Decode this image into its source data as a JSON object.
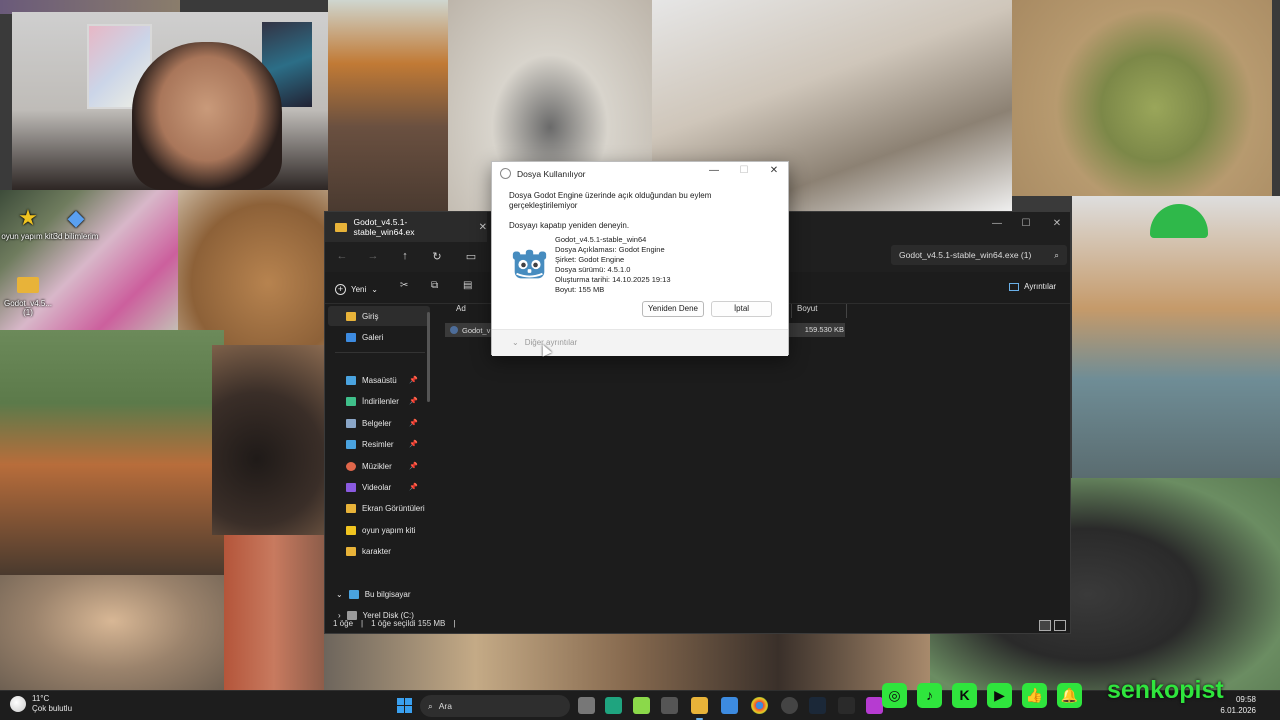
{
  "desktop": {
    "icons": [
      {
        "label": "oyun yapım kiti",
        "icon": "star-shortcut-icon"
      },
      {
        "label": "3d bilimlerim",
        "icon": "paint-3d-icon"
      },
      {
        "label": "Godot_v4.5...(1)",
        "icon": "folder-icon"
      }
    ]
  },
  "explorer": {
    "tab_title": "Godot_v4.5.1-stable_win64.ex",
    "search_placeholder": "Godot_v4.5.1-stable_win64.exe (1)",
    "toolbar": {
      "new_label": "Yeni",
      "details_label": "Ayrıntılar"
    },
    "sidebar": {
      "items": [
        {
          "label": "Giriş",
          "icon": "home-icon",
          "color": "#e8b339"
        },
        {
          "label": "Galeri",
          "icon": "gallery-icon",
          "color": "#3d8be0"
        },
        {
          "label": "Masaüstü",
          "icon": "desktop-icon",
          "color": "#4aa3df"
        },
        {
          "label": "İndirilenler",
          "icon": "download-icon",
          "color": "#3fbf8a"
        },
        {
          "label": "Belgeler",
          "icon": "documents-icon",
          "color": "#8aa6c8"
        },
        {
          "label": "Resimler",
          "icon": "pictures-icon",
          "color": "#4aa3df"
        },
        {
          "label": "Müzikler",
          "icon": "music-icon",
          "color": "#e0664a"
        },
        {
          "label": "Videolar",
          "icon": "videos-icon",
          "color": "#8a5ae0"
        },
        {
          "label": "Ekran Görüntüleri",
          "icon": "folder-icon",
          "color": "#e8b339"
        },
        {
          "label": "oyun yapım kiti",
          "icon": "star-folder-icon",
          "color": "#f0c420"
        },
        {
          "label": "karakter",
          "icon": "folder-icon",
          "color": "#e8b339"
        },
        {
          "label": "Bu bilgisayar",
          "icon": "computer-icon",
          "color": "#4aa3df"
        },
        {
          "label": "Yerel Disk (C:)",
          "icon": "drive-icon",
          "color": "#9a9a9a"
        }
      ]
    },
    "columns": {
      "name": "Ad",
      "size": "Boyut"
    },
    "file": {
      "name": "Godot_v",
      "size": "159.530 KB"
    },
    "status": {
      "count": "1 öğe",
      "selected": "1 öğe seçildi  155 MB"
    }
  },
  "dialog": {
    "title": "Dosya Kullanılıyor",
    "message": "Dosya Godot Engine üzerinde açık olduğundan bu eylem gerçekleştirilemiyor",
    "retry_hint": "Dosyayı kapatıp yeniden deneyin.",
    "info": [
      "Godot_v4.5.1-stable_win64",
      "Dosya Açıklaması: Godot Engine",
      "Şirket: Godot Engine",
      "Dosya sürümü: 4.5.1.0",
      "Oluşturma tarihi: 14.10.2025 19:13",
      "Boyut: 155 MB"
    ],
    "retry_button": "Yeniden Dene",
    "cancel_button": "İptal",
    "more_details": "Diğer ayrıntılar"
  },
  "taskbar": {
    "weather_temp": "11°C",
    "weather_desc": "Çok bulutlu",
    "search_label": "Ara",
    "time": "09:58",
    "date": "6.01.2026",
    "brand": "senkopist"
  },
  "colors": {
    "accent": "#3aa0ef",
    "brand_green": "#2fe53d",
    "explorer_bg": "#1c1c1c"
  }
}
